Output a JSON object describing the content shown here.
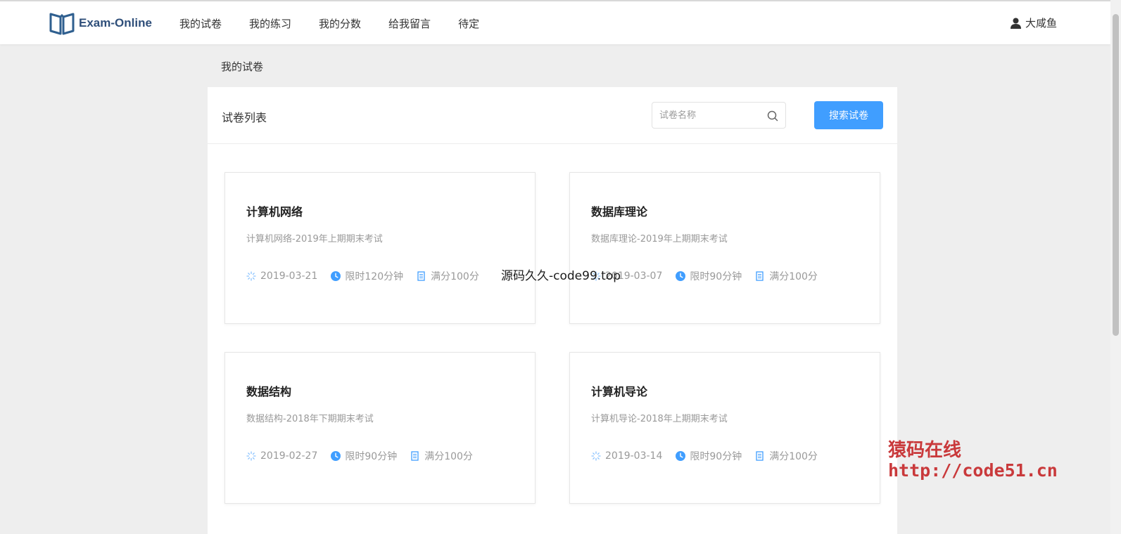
{
  "app": {
    "name": "Exam-Online"
  },
  "nav": {
    "items": [
      {
        "label": "我的试卷"
      },
      {
        "label": "我的练习"
      },
      {
        "label": "我的分数"
      },
      {
        "label": "给我留言"
      },
      {
        "label": "待定"
      }
    ]
  },
  "user": {
    "name": "大咸鱼",
    "icon": "user-icon"
  },
  "breadcrumb": {
    "current": "我的试卷"
  },
  "panel": {
    "title": "试卷列表",
    "search": {
      "placeholder": "试卷名称",
      "value": ""
    },
    "search_button_label": "搜索试卷"
  },
  "papers": [
    {
      "title": "计算机网络",
      "desc": "计算机网络-2019年上期期末考试",
      "date": "2019-03-21",
      "duration": "限时120分钟",
      "score": "满分100分"
    },
    {
      "title": "数据库理论",
      "desc": "数据库理论-2019年上期期末考试",
      "date": "2019-03-07",
      "duration": "限时90分钟",
      "score": "满分100分"
    },
    {
      "title": "数据结构",
      "desc": "数据结构-2018年下期期末考试",
      "date": "2019-02-27",
      "duration": "限时90分钟",
      "score": "满分100分"
    },
    {
      "title": "计算机导论",
      "desc": "计算机导论-2018年上期期末考试",
      "date": "2019-03-14",
      "duration": "限时90分钟",
      "score": "满分100分"
    }
  ],
  "watermarks": {
    "center": "源码久久-code99.top",
    "corner_title": "猿码在线",
    "corner_url": "http://code51.cn"
  },
  "colors": {
    "accent": "#409eff",
    "brand": "#2f4f7a",
    "watermark": "#c9393b"
  }
}
